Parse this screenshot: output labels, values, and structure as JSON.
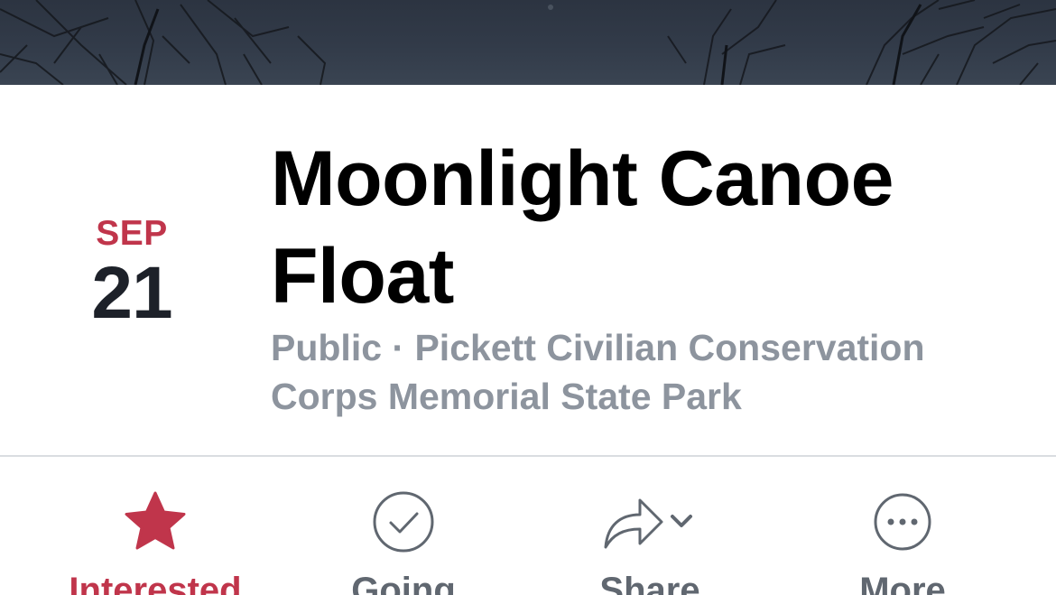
{
  "event": {
    "date": {
      "month": "SEP",
      "day": "21"
    },
    "title": "Moonlight Canoe Float",
    "subtitle": "Public · Pickett Civilian Conservation Corps Memorial State Park"
  },
  "actions": [
    {
      "label": "Interested",
      "icon": "star-icon",
      "active": true
    },
    {
      "label": "Going",
      "icon": "check-circle-icon",
      "active": false
    },
    {
      "label": "Share",
      "icon": "share-arrow-icon",
      "active": false
    },
    {
      "label": "More",
      "icon": "more-dots-icon",
      "active": false
    }
  ],
  "colors": {
    "accent": "#c0354b",
    "text_primary": "#000000",
    "text_secondary": "#8d949e",
    "icon_gray": "#606770"
  }
}
